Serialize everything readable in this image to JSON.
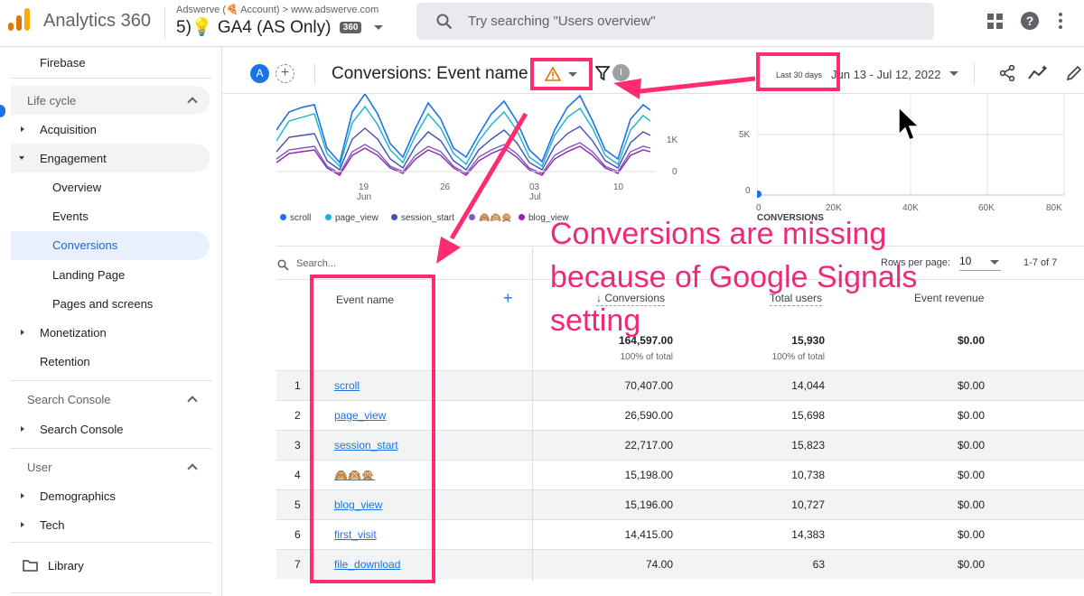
{
  "app": {
    "title": "Analytics 360",
    "account_line": "Adswerve (🍕 Account) > www.adswerve.com",
    "property_name": "5)💡 GA4 (AS Only)",
    "property_badge": "360",
    "search_placeholder": "Try searching \"Users overview\""
  },
  "sidebar": {
    "top_item": "Firebase",
    "sections": [
      {
        "title": "Life cycle",
        "items": [
          "Acquisition",
          "Engagement",
          "Overview",
          "Events",
          "Conversions",
          "Landing Page",
          "Pages and screens",
          "Monetization",
          "Retention"
        ]
      },
      {
        "title": "Search Console",
        "items": [
          "Search Console"
        ]
      },
      {
        "title": "User",
        "items": [
          "Demographics",
          "Tech"
        ]
      }
    ],
    "library": "Library",
    "active_item": "Conversions"
  },
  "report": {
    "avatar_letter": "A",
    "title": "Conversions: Event name",
    "info_letter": "I",
    "date_label": "Last 30 days",
    "date_range": "Jun 13 - Jul 12, 2022"
  },
  "line_chart": {
    "y_ticks": [
      "1K",
      "0"
    ],
    "x_ticks": [
      {
        "d": "19",
        "m": "Jun"
      },
      {
        "d": "26",
        "m": ""
      },
      {
        "d": "03",
        "m": "Jul"
      },
      {
        "d": "10",
        "m": ""
      }
    ],
    "legend": [
      {
        "label": "scroll",
        "color": "#1a73e8"
      },
      {
        "label": "page_view",
        "color": "#12b5cb"
      },
      {
        "label": "session_start",
        "color": "#3f51b5"
      },
      {
        "label": "🙈🙉🙊",
        "color": "#7e57c2"
      },
      {
        "label": "blog_view",
        "color": "#8e24aa"
      }
    ]
  },
  "scatter_chart": {
    "y_ticks": [
      "5K",
      "0"
    ],
    "x_ticks": [
      "0",
      "20K",
      "40K",
      "60K",
      "80K"
    ],
    "x_label": "CONVERSIONS"
  },
  "table": {
    "search_placeholder": "Search...",
    "rows_per_page_label": "Rows per page:",
    "rows_per_page": "10",
    "pagination": "1-7 of 7",
    "columns": [
      "Event name",
      "↓ Conversions",
      "Total users",
      "Event revenue"
    ],
    "totals": {
      "conversions": "164,597.00",
      "users": "15,930",
      "revenue": "$0.00",
      "pct": "100% of total"
    },
    "rows": [
      {
        "n": "1",
        "name": "scroll",
        "conv": "70,407.00",
        "users": "14,044",
        "rev": "$0.00"
      },
      {
        "n": "2",
        "name": "page_view",
        "conv": "26,590.00",
        "users": "15,698",
        "rev": "$0.00"
      },
      {
        "n": "3",
        "name": "session_start",
        "conv": "22,717.00",
        "users": "15,823",
        "rev": "$0.00"
      },
      {
        "n": "4",
        "name": "🙈🙉🙊",
        "conv": "15,198.00",
        "users": "10,738",
        "rev": "$0.00"
      },
      {
        "n": "5",
        "name": "blog_view",
        "conv": "15,196.00",
        "users": "10,727",
        "rev": "$0.00"
      },
      {
        "n": "6",
        "name": "first_visit",
        "conv": "14,415.00",
        "users": "14,383",
        "rev": "$0.00"
      },
      {
        "n": "7",
        "name": "file_download",
        "conv": "74.00",
        "users": "63",
        "rev": "$0.00"
      }
    ]
  },
  "annotation": {
    "text": "Conversions are missing because of Google Signals setting",
    "color": "#f0287a"
  }
}
